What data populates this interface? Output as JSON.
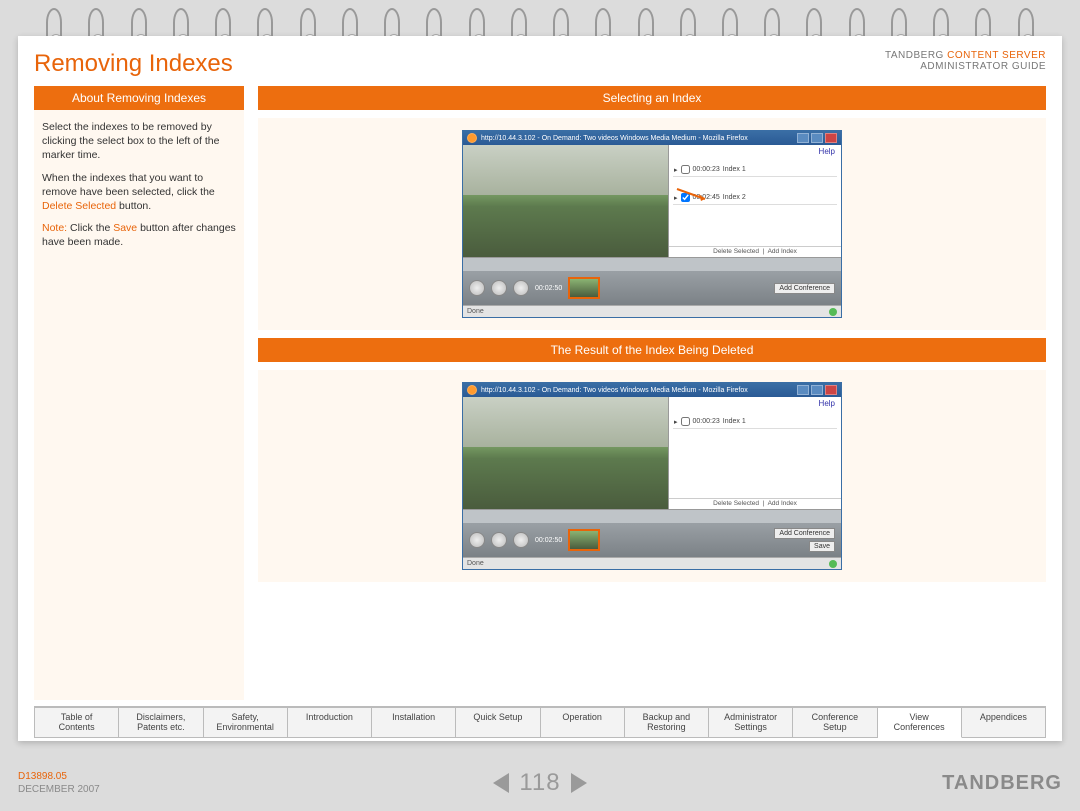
{
  "header": {
    "title": "Removing Indexes",
    "brand_company": "TANDBERG",
    "brand_product": "CONTENT SERVER",
    "brand_sub": "ADMINISTRATOR GUIDE"
  },
  "about": {
    "bar": "About Removing Indexes",
    "p1": "Select the indexes to be removed by clicking the select box to the left of the marker time.",
    "p2a": "When the indexes that you want to remove have been selected, click the ",
    "p2b": "Delete Selected",
    "p2c": " button.",
    "p3a": "Note:",
    "p3b": " Click the ",
    "p3c": "Save",
    "p3d": " button after changes have been made."
  },
  "section1": {
    "bar": "Selecting an Index"
  },
  "section2": {
    "bar": "The Result of the Index Being Deleted"
  },
  "browser": {
    "title": "http://10.44.3.102 - On Demand: Two videos Windows Media Medium - Mozilla Firefox",
    "help": "Help",
    "idx1_time": "00:00:23",
    "idx1_label": "Index 1",
    "idx2_time": "00:02:45",
    "idx2_label": "Index 2",
    "delete_selected": "Delete Selected",
    "add_index": "Add Index",
    "timecode": "00:02:50",
    "add_conference": "Add Conference",
    "save": "Save",
    "done": "Done"
  },
  "tabs": [
    "Table of\nContents",
    "Disclaimers,\nPatents etc.",
    "Safety,\nEnvironmental",
    "Introduction",
    "Installation",
    "Quick Setup",
    "Operation",
    "Backup and\nRestoring",
    "Administrator\nSettings",
    "Conference\nSetup",
    "View\nConferences",
    "Appendices"
  ],
  "active_tab_index": 10,
  "footer": {
    "docnum": "D13898.05",
    "date": "DECEMBER 2007",
    "page": "118",
    "logo": "TANDBERG"
  }
}
